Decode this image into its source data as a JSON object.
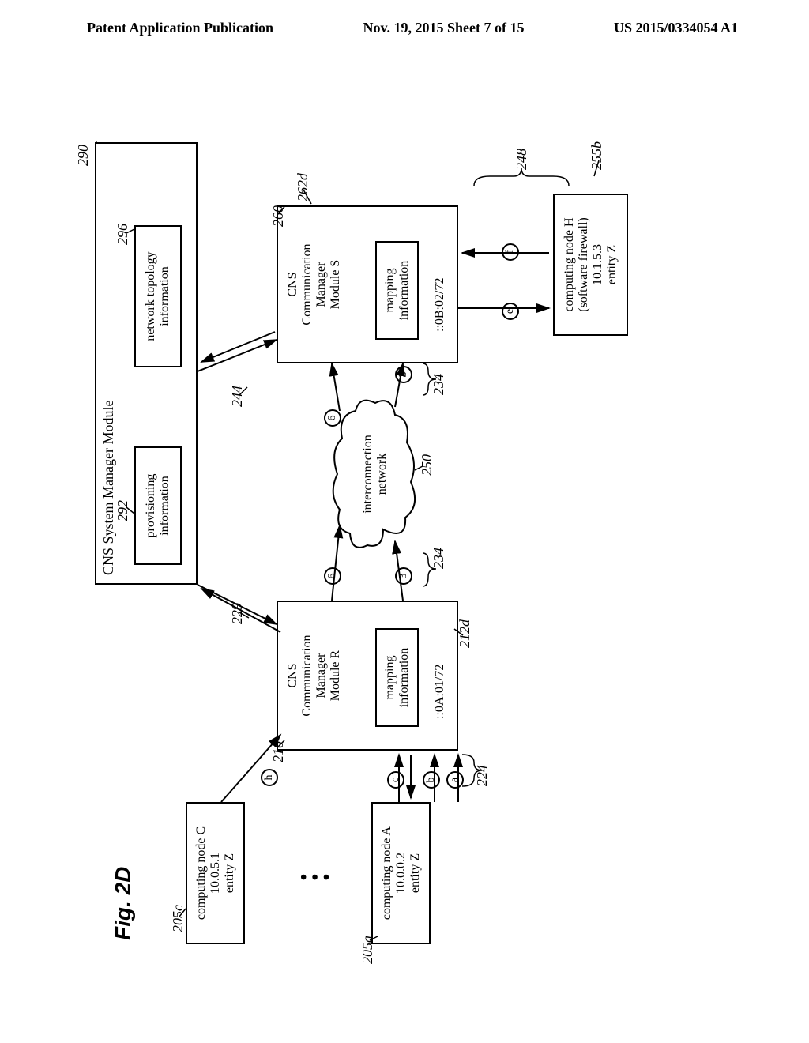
{
  "header": {
    "left": "Patent Application Publication",
    "center": "Nov. 19, 2015  Sheet 7 of 15",
    "right": "US 2015/0334054 A1"
  },
  "figure_title": "Fig. 2D",
  "boxes": {
    "system_manager": "CNS System Manager Module",
    "provisioning": "provisioning\ninformation",
    "topology": "network topology\ninformation",
    "comm_mgr_r": "CNS\nCommunication\nManager\nModule R",
    "comm_mgr_s": "CNS\nCommunication\nManager\nModule S",
    "mapping_r": "mapping\ninformation",
    "mapping_s": "mapping\ninformation",
    "node_c": "computing node C\n10.0.5.1\nentity Z",
    "node_a": "computing node A\n10.0.0.2\nentity Z",
    "node_h": "computing node H\n(software firewall)\n10.1.5.3\nentity Z",
    "addr_r": "::0A:01/72",
    "addr_s": "::0B:02/72"
  },
  "cloud_label": "interconnection\nnetwork",
  "refs": {
    "r290": "290",
    "r292": "292",
    "r296": "296",
    "r210": "210",
    "r260": "260",
    "r205c": "205c",
    "r205a": "205a",
    "r212d": "212d",
    "r262d": "262d",
    "r224": "224",
    "r229": "229",
    "r244": "244",
    "r234": "234",
    "r234b": "234",
    "r248": "248",
    "r250": "250",
    "r255b": "255b"
  },
  "flows": {
    "a": "a",
    "b": "b",
    "c": "c",
    "e": "e",
    "f": "f",
    "h": "h",
    "three": "3",
    "six": "6"
  }
}
